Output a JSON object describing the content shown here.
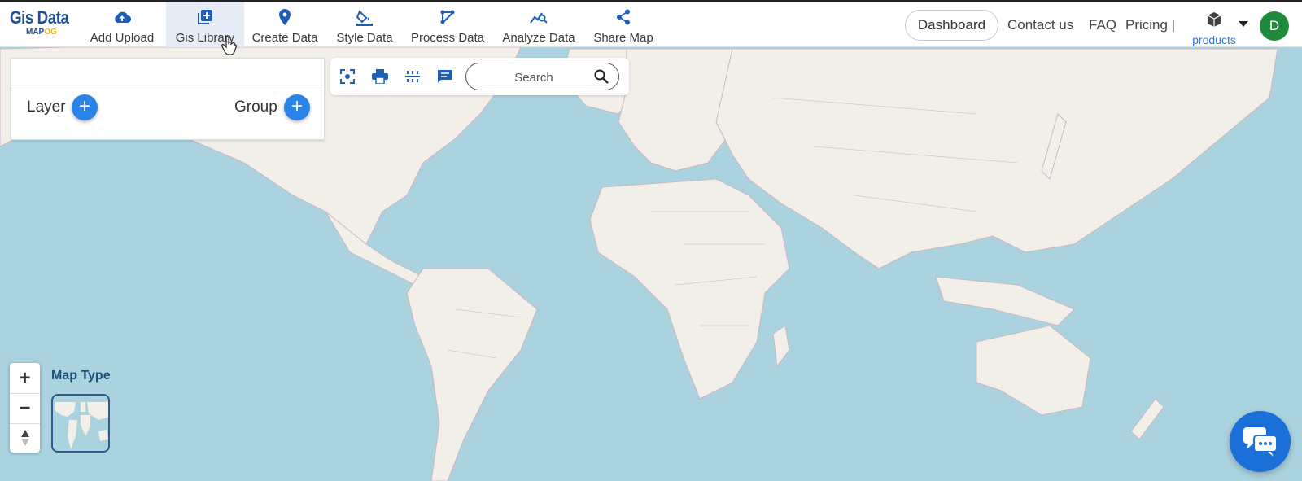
{
  "brand": {
    "line1": "Gis Data",
    "line2_a": "MAP",
    "line2_b": "OG"
  },
  "nav": [
    {
      "label": "Add Upload",
      "icon": "cloud-upload-icon"
    },
    {
      "label": "Gis Library",
      "icon": "library-add-icon",
      "active": true
    },
    {
      "label": "Create Data",
      "icon": "map-pin-icon"
    },
    {
      "label": "Style Data",
      "icon": "paint-bucket-icon"
    },
    {
      "label": "Process Data",
      "icon": "process-icon"
    },
    {
      "label": "Analyze Data",
      "icon": "analyze-icon"
    },
    {
      "label": "Share Map",
      "icon": "share-icon"
    }
  ],
  "header": {
    "dashboard": "Dashboard",
    "contact": "Contact us",
    "faq": "FAQ",
    "pricing": "Pricing |",
    "products": "products",
    "avatar_initial": "D"
  },
  "layer_panel": {
    "layer_label": "Layer",
    "group_label": "Group"
  },
  "toolbar": {
    "icons": [
      "fullscreen-icon",
      "print-icon",
      "measure-icon",
      "comment-icon"
    ],
    "search_placeholder": "Search"
  },
  "map_controls": {
    "zoom_in": "+",
    "zoom_out": "−",
    "reset": "▲",
    "map_type_label": "Map Type"
  },
  "colors": {
    "accent": "#2a84e8",
    "brand": "#1d4f91",
    "water": "#aad3df",
    "land": "#f2efe9",
    "avatar": "#1f8a3c"
  }
}
